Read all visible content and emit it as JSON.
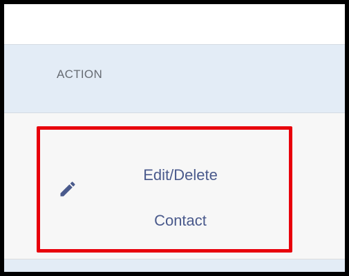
{
  "table": {
    "header": {
      "action": "ACTION"
    },
    "rows": [
      {
        "action_label": "Edit/Delete\nContact",
        "action_icon": "pencil-icon"
      }
    ]
  },
  "colors": {
    "highlight": "#e8000b",
    "link": "#4a5a8c",
    "header_bg": "#e3ecf6",
    "header_text": "#666b72"
  }
}
